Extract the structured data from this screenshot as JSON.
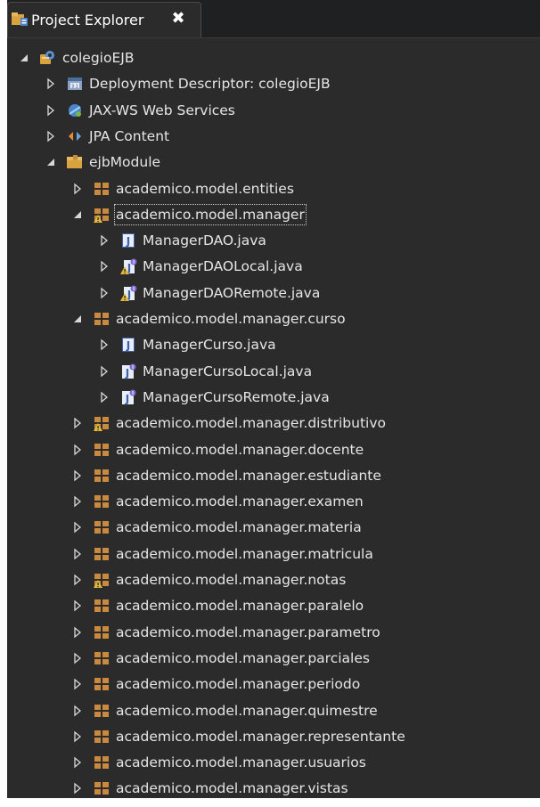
{
  "tab": {
    "title": "Project Explorer",
    "close": "✖"
  },
  "tree": [
    {
      "depth": 0,
      "expanded": true,
      "icon": "ejb-project-icon",
      "label": "colegioEJB"
    },
    {
      "depth": 1,
      "expanded": false,
      "icon": "deployment-descriptor-icon",
      "label": "Deployment Descriptor: colegioEJB"
    },
    {
      "depth": 1,
      "expanded": false,
      "icon": "web-services-icon",
      "label": "JAX-WS Web Services"
    },
    {
      "depth": 1,
      "expanded": false,
      "icon": "jpa-content-icon",
      "label": "JPA Content"
    },
    {
      "depth": 1,
      "expanded": true,
      "icon": "source-folder-icon",
      "label": "ejbModule"
    },
    {
      "depth": 2,
      "expanded": false,
      "icon": "package-icon",
      "label": "academico.model.entities"
    },
    {
      "depth": 2,
      "expanded": true,
      "icon": "package-warning-icon",
      "label": "academico.model.manager",
      "selected": true
    },
    {
      "depth": 3,
      "expanded": false,
      "icon": "java-class-icon",
      "label": "ManagerDAO.java"
    },
    {
      "depth": 3,
      "expanded": false,
      "icon": "java-interface-warning-icon",
      "label": "ManagerDAOLocal.java"
    },
    {
      "depth": 3,
      "expanded": false,
      "icon": "java-interface-warning-icon",
      "label": "ManagerDAORemote.java"
    },
    {
      "depth": 2,
      "expanded": true,
      "icon": "package-icon",
      "label": "academico.model.manager.curso"
    },
    {
      "depth": 3,
      "expanded": false,
      "icon": "java-class-icon",
      "label": "ManagerCurso.java"
    },
    {
      "depth": 3,
      "expanded": false,
      "icon": "java-interface-icon",
      "label": "ManagerCursoLocal.java"
    },
    {
      "depth": 3,
      "expanded": false,
      "icon": "java-interface-icon",
      "label": "ManagerCursoRemote.java"
    },
    {
      "depth": 2,
      "expanded": false,
      "icon": "package-warning-icon",
      "label": "academico.model.manager.distributivo"
    },
    {
      "depth": 2,
      "expanded": false,
      "icon": "package-icon",
      "label": "academico.model.manager.docente"
    },
    {
      "depth": 2,
      "expanded": false,
      "icon": "package-icon",
      "label": "academico.model.manager.estudiante"
    },
    {
      "depth": 2,
      "expanded": false,
      "icon": "package-icon",
      "label": "academico.model.manager.examen"
    },
    {
      "depth": 2,
      "expanded": false,
      "icon": "package-icon",
      "label": "academico.model.manager.materia"
    },
    {
      "depth": 2,
      "expanded": false,
      "icon": "package-icon",
      "label": "academico.model.manager.matricula"
    },
    {
      "depth": 2,
      "expanded": false,
      "icon": "package-warning-icon",
      "label": "academico.model.manager.notas"
    },
    {
      "depth": 2,
      "expanded": false,
      "icon": "package-icon",
      "label": "academico.model.manager.paralelo"
    },
    {
      "depth": 2,
      "expanded": false,
      "icon": "package-icon",
      "label": "academico.model.manager.parametro"
    },
    {
      "depth": 2,
      "expanded": false,
      "icon": "package-icon",
      "label": "academico.model.manager.parciales"
    },
    {
      "depth": 2,
      "expanded": false,
      "icon": "package-icon",
      "label": "academico.model.manager.periodo"
    },
    {
      "depth": 2,
      "expanded": false,
      "icon": "package-icon",
      "label": "academico.model.manager.quimestre"
    },
    {
      "depth": 2,
      "expanded": false,
      "icon": "package-icon",
      "label": "academico.model.manager.representante"
    },
    {
      "depth": 2,
      "expanded": false,
      "icon": "package-icon",
      "label": "academico.model.manager.usuarios"
    },
    {
      "depth": 2,
      "expanded": false,
      "icon": "package-icon",
      "label": "academico.model.manager.vistas"
    }
  ],
  "colors": {
    "background": "#2b2b2b",
    "text": "#e6e6e6",
    "package": "#c98a3f",
    "java_class": "#5a82c8",
    "interface": "#7d6fd1",
    "warning": "#e2b93b"
  }
}
